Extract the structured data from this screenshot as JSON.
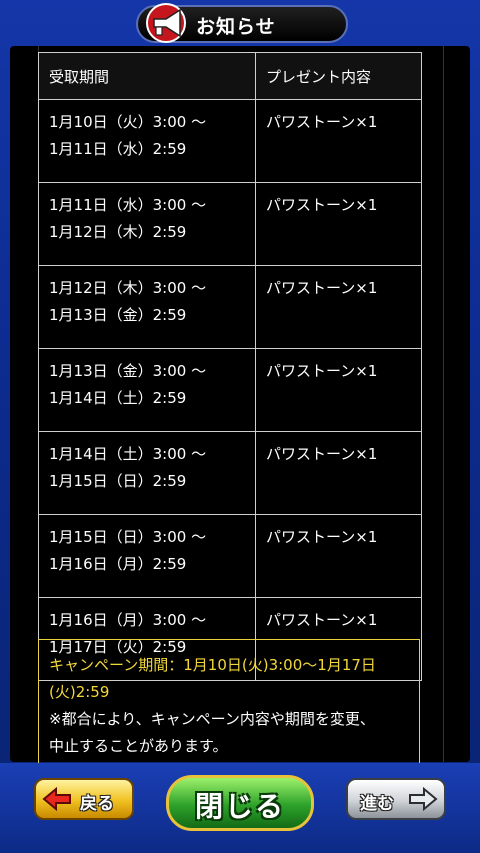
{
  "header": {
    "title": "お知らせ"
  },
  "table": {
    "headers": [
      "受取期間",
      "プレゼント内容"
    ],
    "rows": [
      {
        "period_start": "1月10日（火）3:00 〜",
        "period_end": "1月11日（水）2:59",
        "present": "パワストーン×1"
      },
      {
        "period_start": "1月11日（水）3:00 〜",
        "period_end": "1月12日（木）2:59",
        "present": "パワストーン×1"
      },
      {
        "period_start": "1月12日（木）3:00 〜",
        "period_end": "1月13日（金）2:59",
        "present": "パワストーン×1"
      },
      {
        "period_start": "1月13日（金）3:00 〜",
        "period_end": "1月14日（土）2:59",
        "present": "パワストーン×1"
      },
      {
        "period_start": "1月14日（土）3:00 〜",
        "period_end": "1月15日（日）2:59",
        "present": "パワストーン×1"
      },
      {
        "period_start": "1月15日（日）3:00 〜",
        "period_end": "1月16日（月）2:59",
        "present": "パワストーン×1"
      },
      {
        "period_start": "1月16日（月）3:00 〜",
        "period_end": "1月17日（火）2:59",
        "present": "パワストーン×1"
      }
    ]
  },
  "notice": {
    "campaign_line1": "キャンペーン期間：1月10日(火)3:00〜1月17日",
    "campaign_line2": "(火)2:59",
    "note_line1": "※都合により、キャンペーン内容や期間を変更、",
    "note_line2": "中止することがあります。"
  },
  "footer": {
    "back_label": "戻る",
    "close_label": "閉じる",
    "next_label": "進む"
  },
  "colors": {
    "accent_yellow": "#f2d73a",
    "frame_blue": "#1436a8",
    "close_green": "#2da12a"
  }
}
